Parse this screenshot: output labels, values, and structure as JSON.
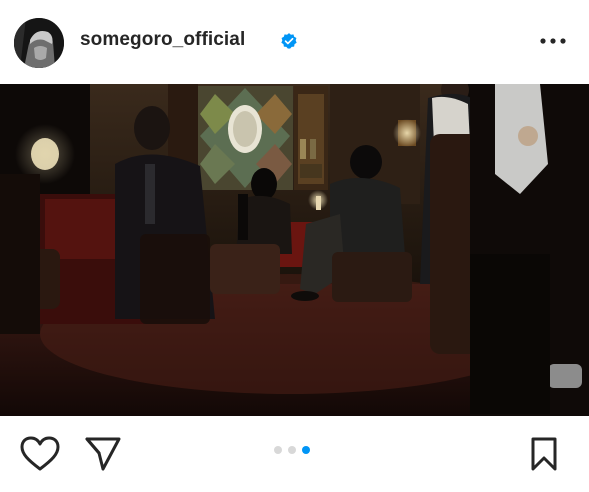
{
  "post": {
    "username": "somegoro_official",
    "verified": true,
    "carousel": {
      "count": 3,
      "active_index": 2
    }
  },
  "icons": {
    "verified": "verified-badge-icon",
    "more": "more-options-icon",
    "like": "heart-icon",
    "share": "paper-plane-icon",
    "save": "bookmark-icon"
  },
  "colors": {
    "text": "#262626",
    "verified": "#0095f6",
    "active_dot": "#0095f6",
    "inactive_dot": "#d8d8d8"
  }
}
